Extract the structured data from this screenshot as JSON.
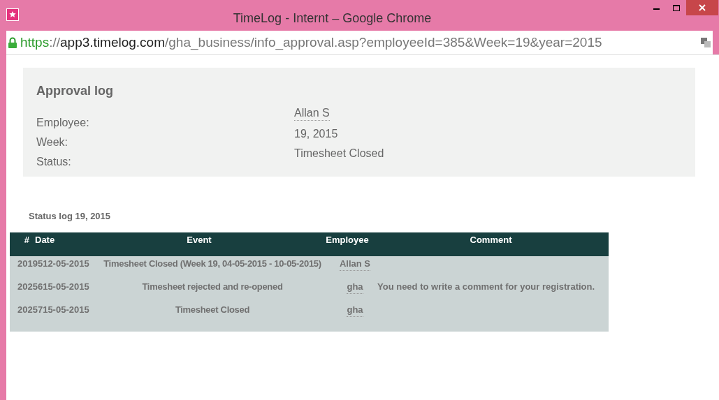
{
  "window": {
    "title": "TimeLog - Internt – Google Chrome"
  },
  "address_bar": {
    "scheme": "https",
    "separator": "://",
    "host": "app3.timelog.com",
    "path": "/gha_business/info_approval.asp?employeeId=385&Week=19&year=2015"
  },
  "approval_log": {
    "title": "Approval log",
    "fields": [
      {
        "label": "Employee:",
        "value": "Allan S",
        "kind": "link"
      },
      {
        "label": "Week:",
        "value": "19, 2015",
        "kind": "text"
      },
      {
        "label": "Status:",
        "value": "Timesheet Closed",
        "kind": "text"
      }
    ]
  },
  "status_log": {
    "title": "Status log 19, 2015",
    "columns": [
      "#",
      "Date",
      "Event",
      "Employee",
      "Comment"
    ],
    "rows": [
      {
        "number": "20195",
        "date": "12-05-2015",
        "event": "Timesheet Closed (Week 19, 04-05-2015 - 10-05-2015)",
        "employee": "Allan S",
        "comment": ""
      },
      {
        "number": "20256",
        "date": "15-05-2015",
        "event": "Timesheet rejected and re-opened",
        "employee": "gha",
        "comment": "You need to write a comment for your registration."
      },
      {
        "number": "20257",
        "date": "15-05-2015",
        "event": "Timesheet Closed",
        "employee": "gha",
        "comment": ""
      }
    ]
  }
}
